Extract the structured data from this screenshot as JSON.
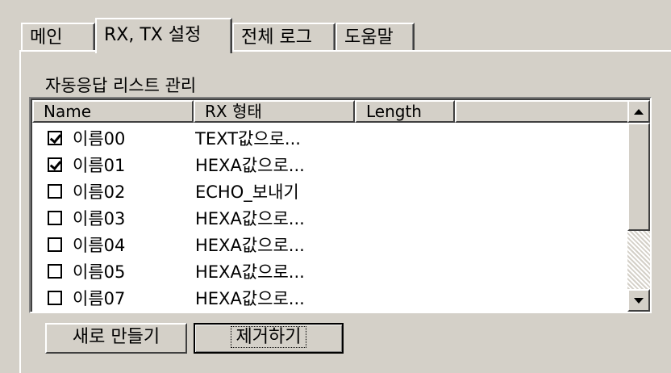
{
  "tabs": [
    {
      "label": "메인"
    },
    {
      "label": "RX, TX 설정"
    },
    {
      "label": "전체 로그"
    },
    {
      "label": "도움말"
    }
  ],
  "group_title": "자동응답 리스트 관리",
  "columns": {
    "name": "Name",
    "rx": "RX 형태",
    "length": "Length"
  },
  "rows": [
    {
      "name": "이름00",
      "rx": "TEXT값으로...",
      "checked": true
    },
    {
      "name": "이름01",
      "rx": "HEXA값으로...",
      "checked": true
    },
    {
      "name": "이름02",
      "rx": "ECHO_보내기",
      "checked": false
    },
    {
      "name": "이름03",
      "rx": "HEXA값으로...",
      "checked": false
    },
    {
      "name": "이름04",
      "rx": "HEXA값으로...",
      "checked": false
    },
    {
      "name": "이름05",
      "rx": "HEXA값으로...",
      "checked": false
    },
    {
      "name": "이름07",
      "rx": "HEXA값으로...",
      "checked": false
    }
  ],
  "buttons": {
    "new": "새로 만들기",
    "remove": "제거하기"
  }
}
